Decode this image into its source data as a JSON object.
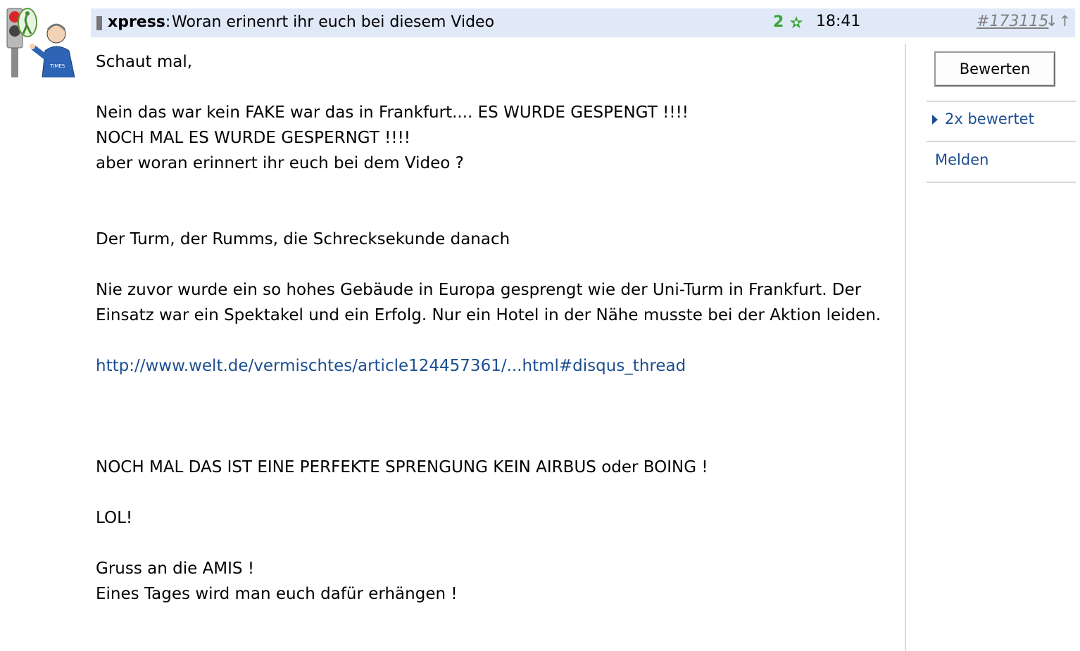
{
  "post": {
    "author": "xpress",
    "title": "Woran erinenrt ihr euch bei diesem Video",
    "rating_count": "2",
    "time": "18:41",
    "post_id": "#173115",
    "nav_arrows": "↓↑",
    "avatar_icon": "avatar-cartoon-icon",
    "star_icon": "green-star-icon",
    "colors": {
      "header_bg": "#e0e9f8",
      "rating_green": "#3aa632",
      "link_blue": "#1d4f91"
    }
  },
  "body": {
    "greeting": "Schaut mal,",
    "line1": "Nein das war kein FAKE war das in Frankfurt.... ES WURDE GESPENGT !!!!",
    "line2": "NOCH MAL ES WURDE GESPERNGT !!!!",
    "line3": "aber woran erinnert ihr euch bei dem Video ?",
    "quote_title": "Der Turm, der Rumms, die Schrecksekunde danach",
    "quote_text": "Nie zuvor wurde ein so hohes Gebäude in Europa gesprengt wie der Uni-Turm in Frankfurt. Der Einsatz war ein Spektakel und ein Erfolg. Nur ein Hotel in der Nähe musste bei der Aktion leiden.",
    "link_text": "http://www.welt.de/vermischtes/article124457361/...html#disqus_thread",
    "line4": "NOCH MAL DAS IST EINE PERFEKTE SPRENGUNG KEIN AIRBUS oder BOING !",
    "line5": "LOL!",
    "line6": "Gruss an die AMIS !",
    "line7": "Eines Tages wird man euch dafür erhängen !"
  },
  "sidebar": {
    "rate_button": "Bewerten",
    "ratings_link": "2x bewertet",
    "report_link": "Melden"
  }
}
